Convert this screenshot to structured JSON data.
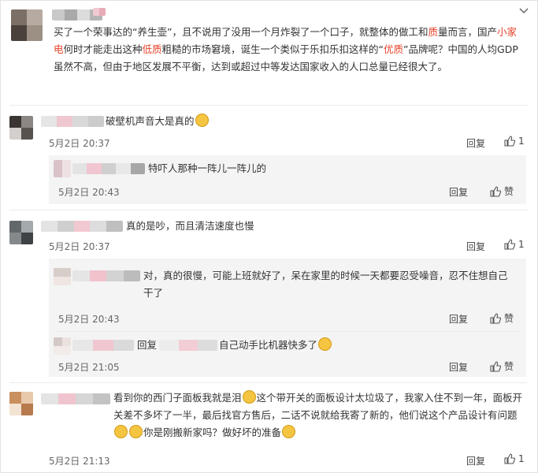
{
  "main_post": {
    "text_parts": [
      {
        "t": "买了一个荣事达的“养生壶”，且不说用了没用一个月炸裂了一个口子，就整体的做工和",
        "red": false
      },
      {
        "t": "质",
        "red": true
      },
      {
        "t": "量而言，国产",
        "red": false
      },
      {
        "t": "小家电",
        "red": true
      },
      {
        "t": "何时才能走出这种",
        "red": false
      },
      {
        "t": "低质",
        "red": true
      },
      {
        "t": "粗糙的市场窘境，诞生一个类似于乐扣乐扣这样的“",
        "red": false
      },
      {
        "t": "优质",
        "red": true
      },
      {
        "t": "”品牌呢？中国的人均GDP虽然不高，但由于地区发展不平衡，达到或超过中等发达国家收入的人口总量已经很大了。",
        "red": false
      }
    ]
  },
  "comments": [
    {
      "text": "破壁机声音大是真的",
      "emoji_after": true,
      "date": "5月2日 20:37",
      "reply": "回复",
      "likes": "1"
    },
    {
      "text": "真的是吵，而且清洁速度也慢",
      "date": "5月2日 20:37",
      "reply": "回复",
      "likes": "1"
    },
    {
      "text": "看到你的西门子面板我就是泪",
      "emoji_mid": true,
      "text2": "这个带开关的面板设计太垃圾了，我家入住不到一年，面板开关差不多坏了一半，最后找官方售后，二话不说就给我寄了新的，他们说这个产品设计有问题",
      "text3": "你是刚搬新家吗？做好坏的准备",
      "date": "5月2日 21:13",
      "reply": "回复",
      "likes": "1"
    }
  ],
  "replies": [
    {
      "text": "特吓人那种一阵儿一阵儿的",
      "date": "5月2日 20:43",
      "reply": "回复",
      "like_label": "赞"
    },
    {
      "text": "对，真的很慢，可能上班就好了，呆在家里的时候一天都要忍受噪音，忍不住想自己干了",
      "date": "5月2日 20:43",
      "reply": "回复",
      "like_label": "赞"
    },
    {
      "prefix": "回复",
      "text": "自己动手比机器快多了",
      "date": "5月2日 21:05",
      "reply": "回复",
      "like_label": "赞"
    }
  ]
}
